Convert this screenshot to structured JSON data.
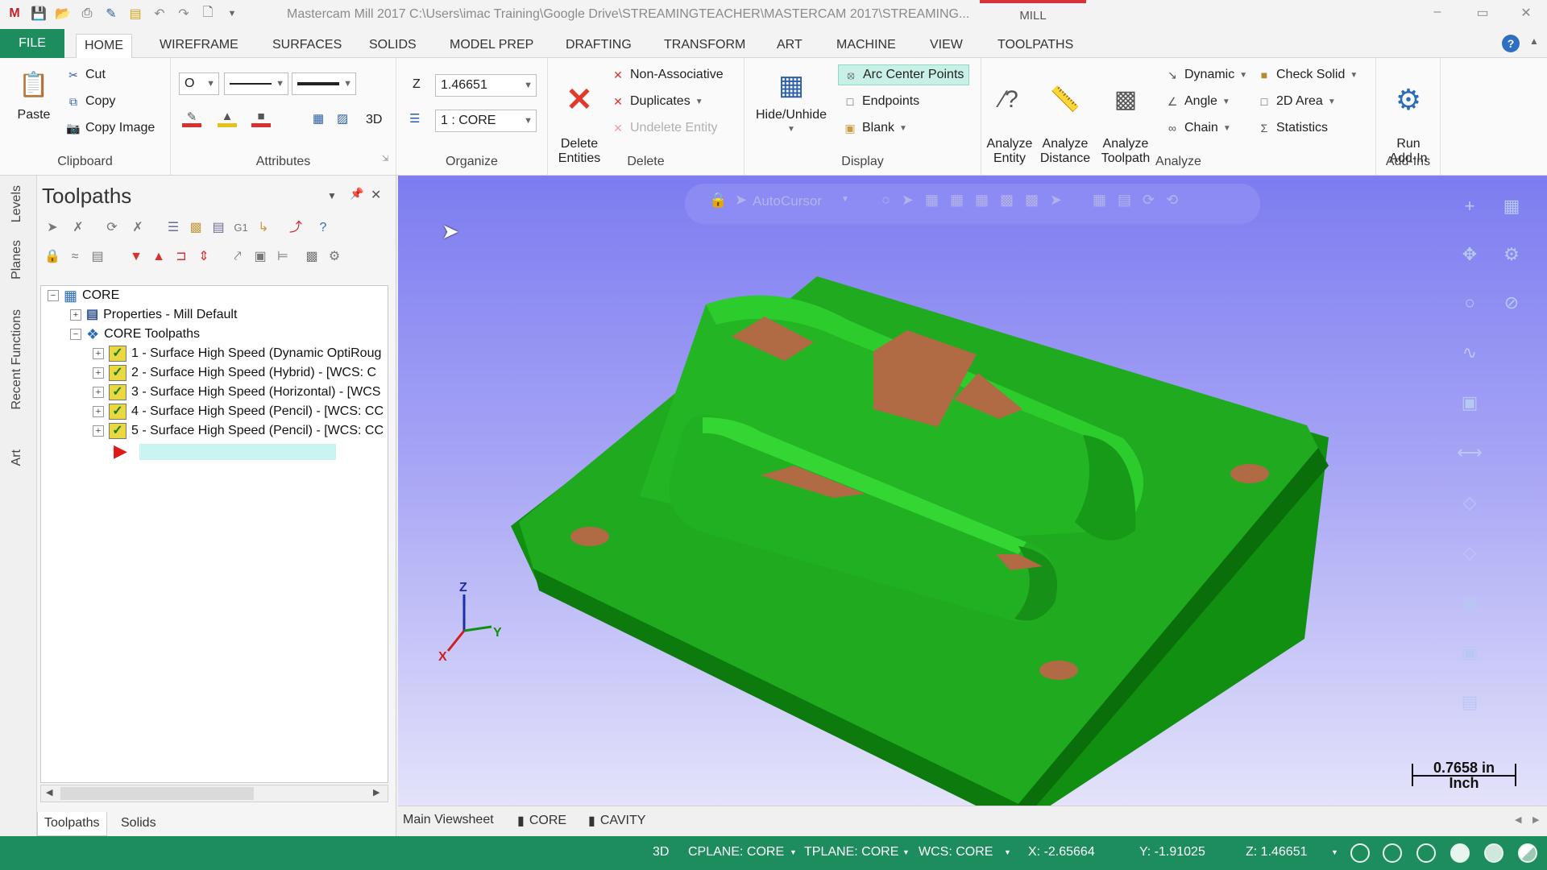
{
  "titlebar": {
    "title": "Mastercam Mill 2017  C:\\Users\\imac Training\\Google Drive\\STREAMINGTEACHER\\MASTERCAM 2017\\STREAMING...",
    "context_tab": "MILL",
    "minimize": "–",
    "restore": "▭",
    "close": "✕"
  },
  "menu": {
    "file": "FILE",
    "tabs": [
      "HOME",
      "WIREFRAME",
      "SURFACES",
      "SOLIDS",
      "MODEL PREP",
      "DRAFTING",
      "TRANSFORM",
      "ART",
      "MACHINE",
      "VIEW",
      "TOOLPATHS"
    ]
  },
  "ribbon": {
    "clipboard": {
      "label": "Clipboard",
      "paste": "Paste",
      "cut": "Cut",
      "copy": "Copy",
      "copy_image": "Copy Image"
    },
    "attributes": {
      "label": "Attributes",
      "point_style": "O",
      "mode_3d": "3D"
    },
    "organize": {
      "label": "Organize",
      "z_label": "Z",
      "z_value": "1.46651",
      "level": "1 : CORE"
    },
    "delete": {
      "label": "Delete",
      "delete_entities": "Delete\nEntities",
      "non_associative": "Non-Associative",
      "duplicates": "Duplicates",
      "undelete": "Undelete Entity"
    },
    "display": {
      "label": "Display",
      "hide_unhide": "Hide/Unhide",
      "arc_center_points": "Arc Center Points",
      "endpoints": "Endpoints",
      "blank": "Blank"
    },
    "analyze": {
      "label": "Analyze",
      "analyze_entity": "Analyze\nEntity",
      "analyze_distance": "Analyze\nDistance",
      "analyze_toolpath": "Analyze\nToolpath",
      "dynamic": "Dynamic",
      "angle": "Angle",
      "chain": "Chain",
      "check_solid": "Check Solid",
      "area_2d": "2D Area",
      "statistics": "Statistics"
    },
    "addins": {
      "label": "Add-Ins",
      "run_addin": "Run\nAdd-In"
    }
  },
  "left_tabs": [
    "Levels",
    "Planes",
    "Recent Functions",
    "Art"
  ],
  "panel": {
    "title": "Toolpaths",
    "tree": {
      "root": "CORE",
      "properties": "Properties - Mill Default",
      "group": "CORE Toolpaths",
      "ops": [
        "1 - Surface High Speed (Dynamic OptiRoug",
        "2 - Surface High Speed (Hybrid) - [WCS: C",
        "3 - Surface High Speed (Horizontal) - [WCS",
        "4 - Surface High Speed (Pencil) - [WCS: CC",
        "5 - Surface High Speed (Pencil) - [WCS: CC"
      ]
    },
    "bottom_tabs": [
      "Toolpaths",
      "Solids"
    ]
  },
  "viewport": {
    "autocursor": "AutoCursor",
    "scale_value": "0.7658 in",
    "scale_unit": "Inch",
    "axis": {
      "z": "Z",
      "y": "Y",
      "x": "X"
    }
  },
  "viewsheets": {
    "main": "Main Viewsheet",
    "core": "CORE",
    "cavity": "CAVITY"
  },
  "status": {
    "mode": "3D",
    "cplane": "CPLANE: CORE",
    "tplane": "TPLANE: CORE",
    "wcs": "WCS: CORE",
    "x": "X:   -2.65664",
    "y": "Y:   -1.91025",
    "z": "Z:   1.46651"
  },
  "colors": {
    "accent": "#1d8d5d",
    "part": "#1fa51f",
    "pad": "#b06a44",
    "viewport_top": "#7d7cf0"
  }
}
